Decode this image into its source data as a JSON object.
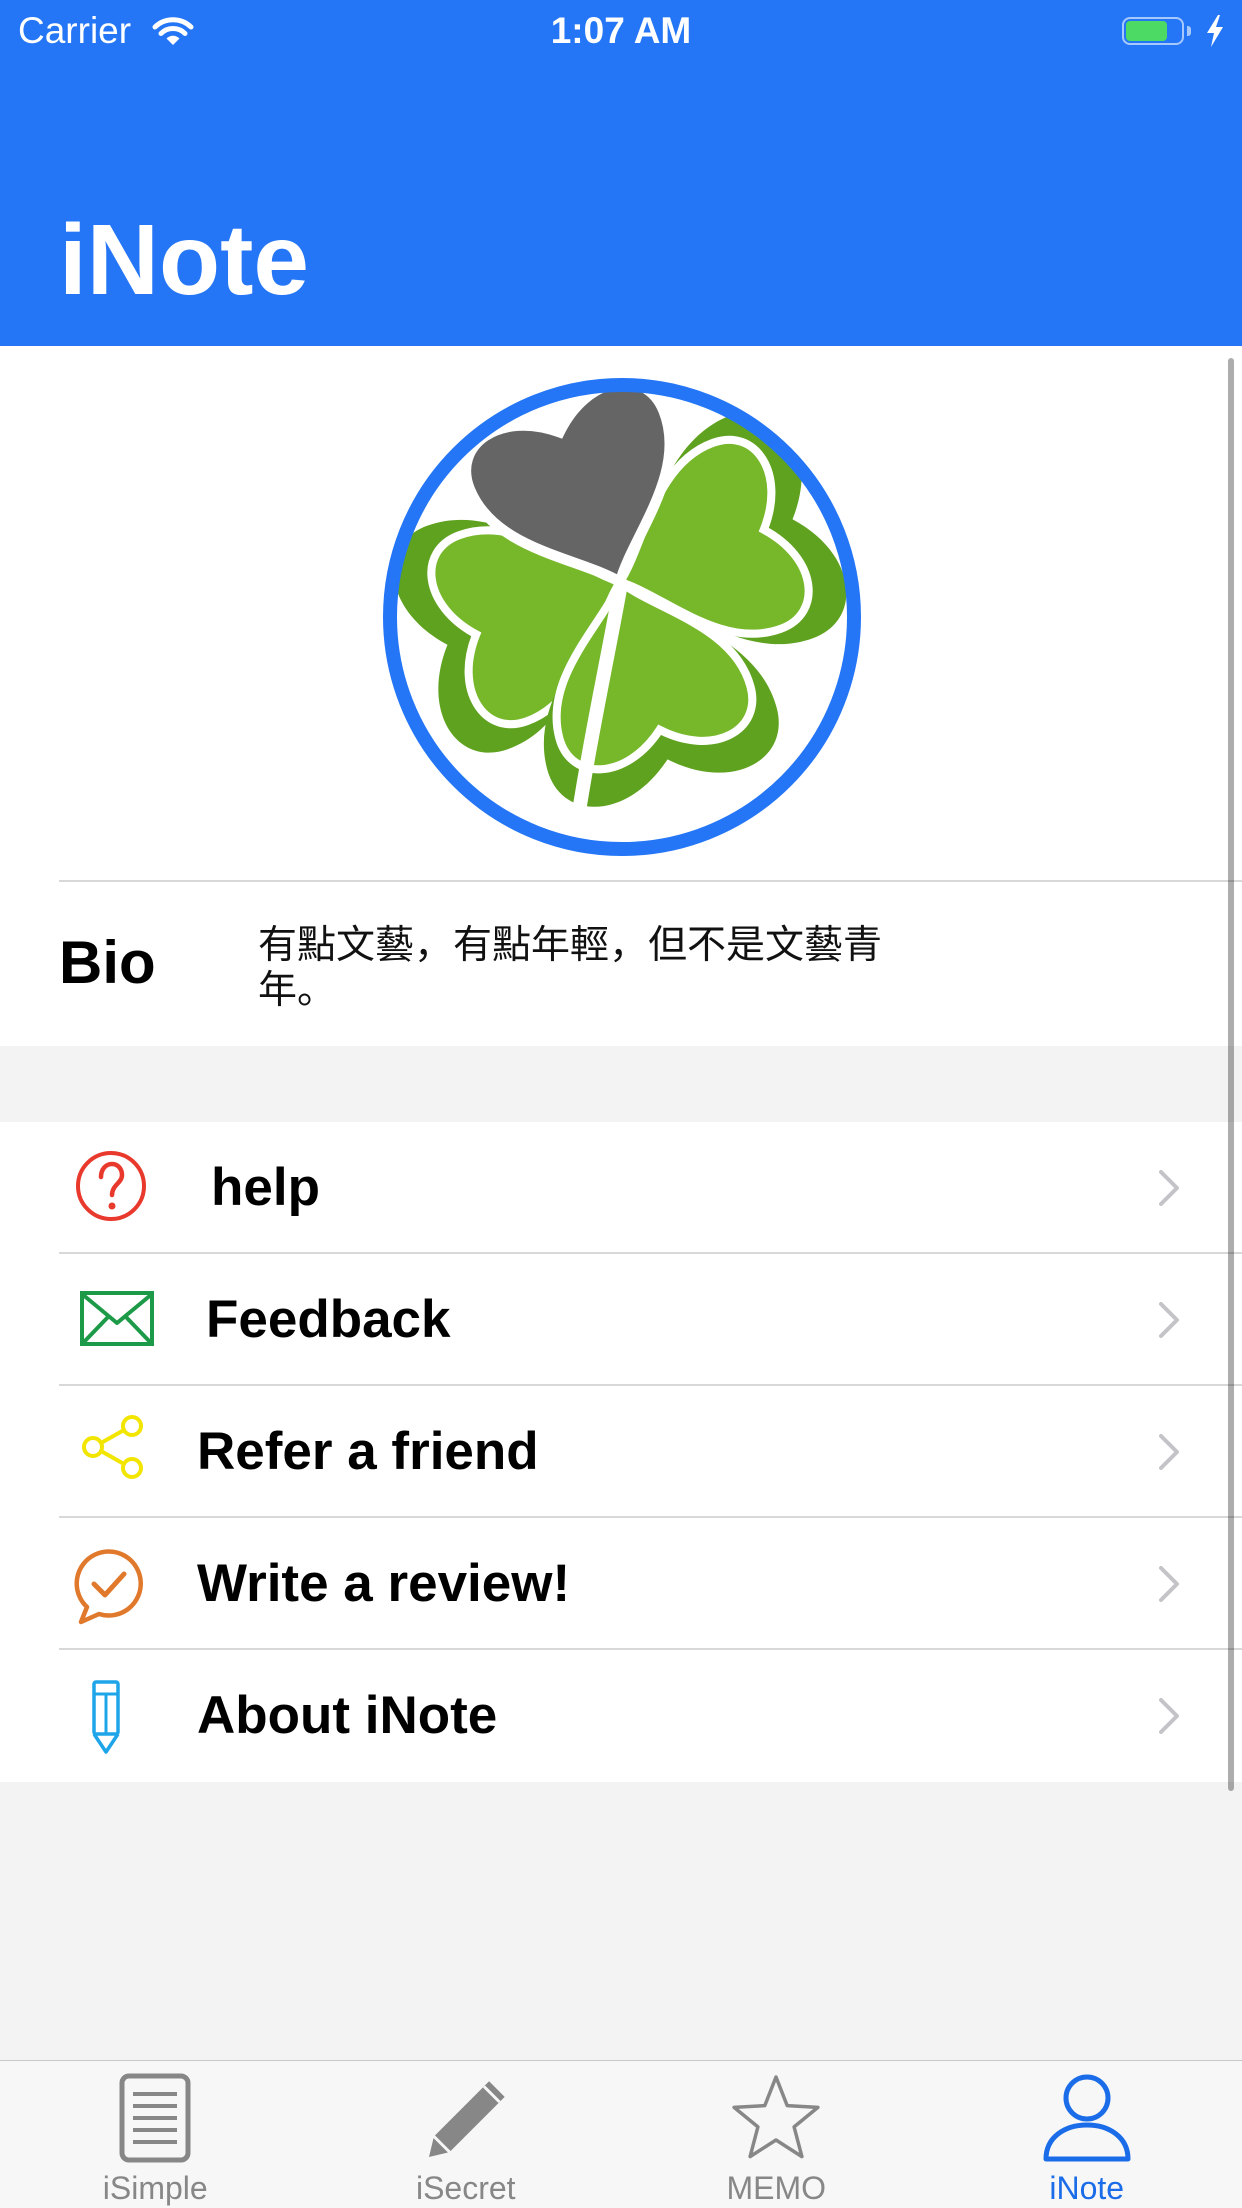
{
  "status_bar": {
    "carrier": "Carrier",
    "time": "1:07 AM",
    "battery_level_percent": 75,
    "icons": [
      "wifi-icon",
      "battery-icon",
      "charging-bolt-icon"
    ]
  },
  "nav": {
    "title": "iNote"
  },
  "profile": {
    "avatar_icon": "four-leaf-clover-icon",
    "bio_label": "Bio",
    "bio_text": "有點文藝，有點年輕，但不是文藝青年。"
  },
  "menu": {
    "items": [
      {
        "label": "help",
        "icon": "question-circle-icon",
        "color": "#E8392C"
      },
      {
        "label": "Feedback",
        "icon": "envelope-icon",
        "color": "#1D9A48"
      },
      {
        "label": "Refer a friend",
        "icon": "share-icon",
        "color": "#F2E500"
      },
      {
        "label": "Write a review!",
        "icon": "chat-check-icon",
        "color": "#E0792B"
      },
      {
        "label": "About iNote",
        "icon": "pencil-outline-icon",
        "color": "#1EA5E9"
      }
    ],
    "chevron_icon": "chevron-right-icon"
  },
  "tab_bar": {
    "selected_index": 3,
    "items": [
      {
        "label": "iSimple",
        "icon": "document-icon"
      },
      {
        "label": "iSecret",
        "icon": "pencil-icon"
      },
      {
        "label": "MEMO",
        "icon": "star-icon"
      },
      {
        "label": "iNote",
        "icon": "person-icon"
      }
    ]
  },
  "colors": {
    "nav_background": "#2476F6",
    "tab_active": "#1A6CE8",
    "tab_inactive": "#878787",
    "page_background": "#F3F3F3",
    "battery_fill": "#4CD964",
    "chevron": "#C4C4C8",
    "clover_green": "#76B82A",
    "clover_gray": "#656565"
  }
}
